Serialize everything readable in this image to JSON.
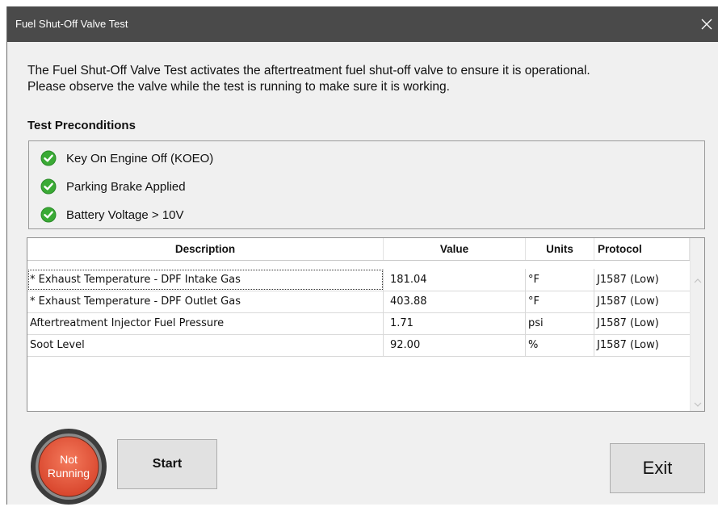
{
  "window": {
    "title": "Fuel Shut-Off Valve Test"
  },
  "description": {
    "line1": "The Fuel Shut-Off Valve Test activates the aftertreatment fuel shut-off valve to ensure it is operational.",
    "line2": "Please observe the valve while the test is running to make sure it is working."
  },
  "preconditions": {
    "title": "Test Preconditions",
    "items": [
      {
        "label": "Key On Engine Off (KOEO)",
        "status": "check-icon"
      },
      {
        "label": "Parking Brake Applied",
        "status": "check-icon"
      },
      {
        "label": "Battery Voltage > 10V",
        "status": "check-icon"
      }
    ]
  },
  "table": {
    "headers": [
      "Description",
      "Value",
      "Units",
      "Protocol"
    ],
    "rows": [
      [
        "* Exhaust Temperature - DPF Intake Gas",
        "181.04",
        "°F",
        "J1587 (Low)"
      ],
      [
        "* Exhaust Temperature - DPF Outlet Gas",
        "403.88",
        "°F",
        "J1587 (Low)"
      ],
      [
        "Aftertreatment Injector Fuel Pressure",
        "1.71",
        "psi",
        "J1587 (Low)"
      ],
      [
        "Soot Level",
        "92.00",
        "%",
        "J1587 (Low)"
      ]
    ]
  },
  "status": {
    "line1": "Not",
    "line2": "Running"
  },
  "buttons": {
    "start": "Start",
    "exit": "Exit"
  },
  "colors": {
    "titlebar": "#4a4a4a",
    "check": "#3aaa35",
    "status_red": "#e0523a",
    "status_ring": "#3c3c3c"
  }
}
